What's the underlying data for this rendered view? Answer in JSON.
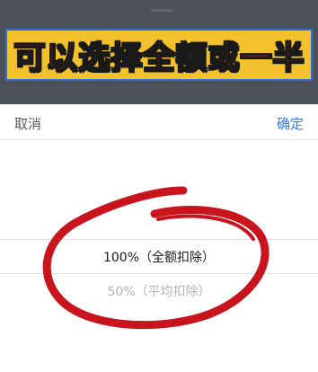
{
  "banner": {
    "text": "可以选择全额或一半"
  },
  "toolbar": {
    "cancel_label": "取消",
    "confirm_label": "确定"
  },
  "picker": {
    "options": [
      {
        "label": "100%（全额扣除）",
        "selected": true
      },
      {
        "label": "50%（平均扣除）",
        "selected": false
      }
    ]
  },
  "colors": {
    "overlay": "#4b5059",
    "banner_bg": "#f2c12c",
    "banner_text": "#ff3b3b",
    "banner_border": "#2b6fe0",
    "confirm": "#3a7bd5",
    "annotation": "#c8141c"
  }
}
